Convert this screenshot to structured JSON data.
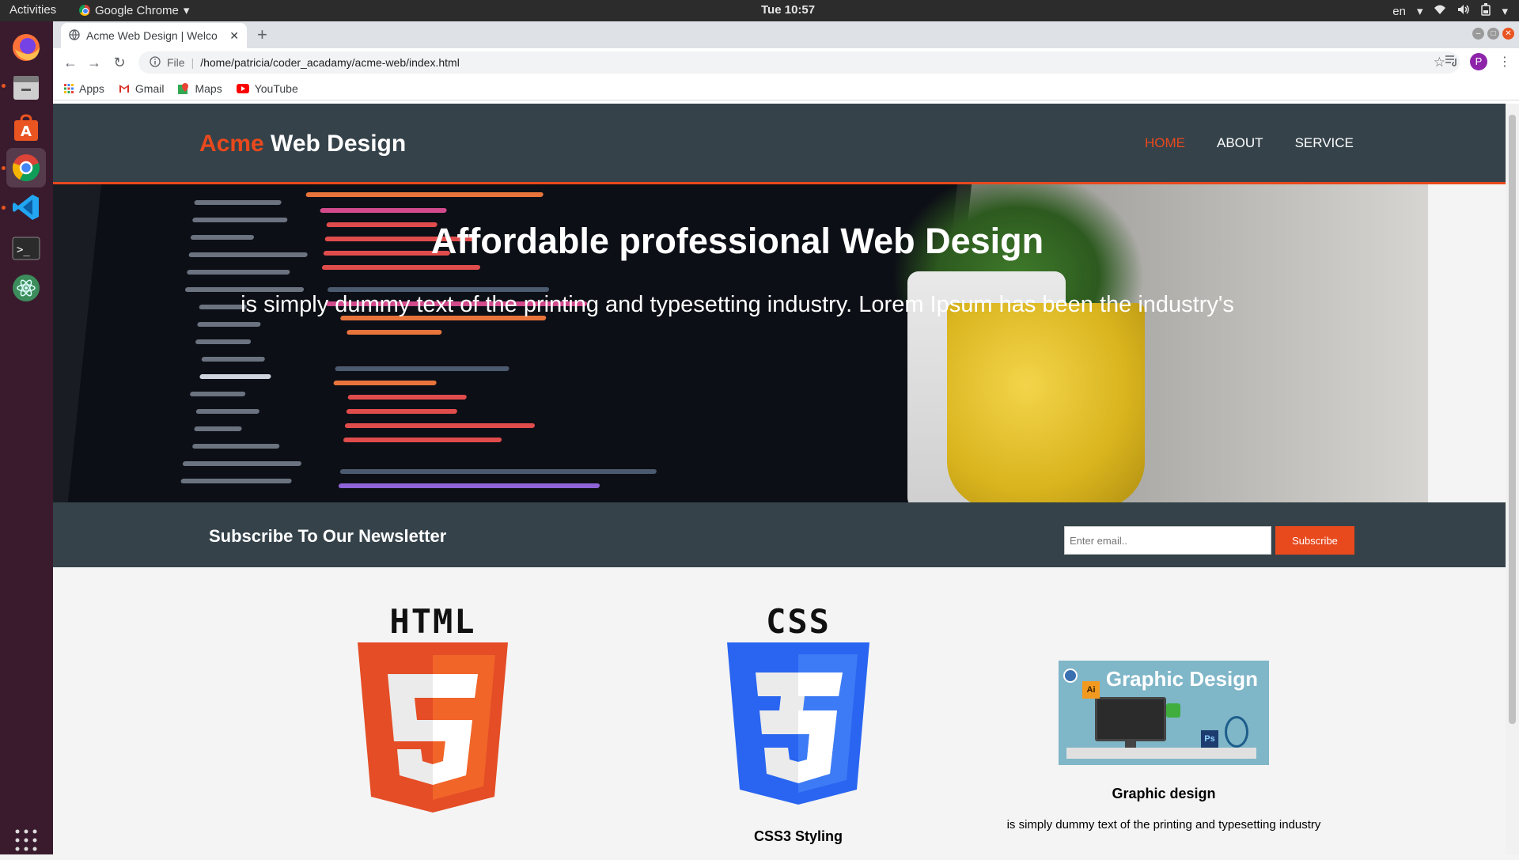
{
  "topbar": {
    "activities": "Activities",
    "app_name": "Google Chrome",
    "clock": "Tue 10:57",
    "lang": "en"
  },
  "browser": {
    "tab_title": "Acme Web Design | Welco",
    "url_scheme": "File",
    "url": "/home/patricia/coder_acadamy/acme-web/index.html",
    "profile_initial": "P",
    "bookmarks": [
      "Apps",
      "Gmail",
      "Maps",
      "YouTube"
    ]
  },
  "site": {
    "brand_highlight": "Acme",
    "brand_rest": " Web Design",
    "nav": [
      "HOME",
      "ABOUT",
      "SERVICE"
    ],
    "showcase": {
      "title": "Affordable professional Web Design",
      "subtitle": "is simply dummy text of the printing and typesetting industry. Lorem Ipsum has been the industry's"
    },
    "newsletter": {
      "title": "Subscribe To Our Newsletter",
      "email_placeholder": "Enter email..",
      "button": "Subscribe"
    },
    "boxes": [
      {
        "logo_text": "HTML",
        "heading": ""
      },
      {
        "logo_text": "CSS",
        "heading": "CSS3 Styling"
      },
      {
        "logo_text": "Graphic Design",
        "heading": "Graphic design",
        "text": "is simply dummy text of the printing and typesetting industry"
      }
    ]
  },
  "colors": {
    "accent": "#e8491d",
    "dark": "#35424a",
    "html5": "#e44d26",
    "css3": "#2965f1"
  }
}
